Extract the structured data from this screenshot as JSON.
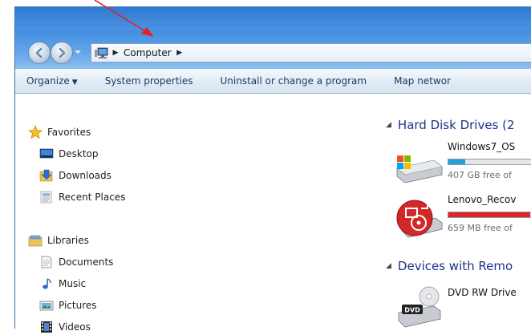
{
  "address_bar": {
    "breadcrumbs": [
      "Computer"
    ]
  },
  "toolbar": {
    "organize": "Organize",
    "system_properties": "System properties",
    "uninstall": "Uninstall or change a program",
    "map_network": "Map networ"
  },
  "nav_pane": {
    "favorites": {
      "label": "Favorites",
      "items": [
        "Desktop",
        "Downloads",
        "Recent Places"
      ]
    },
    "libraries": {
      "label": "Libraries",
      "items": [
        "Documents",
        "Music",
        "Pictures",
        "Videos"
      ]
    }
  },
  "content": {
    "hdd_group": {
      "title": "Hard Disk Drives (2",
      "drives": [
        {
          "name": "Windows7_OS",
          "free": "407 GB free of",
          "used_fraction": 0.2,
          "bar_color": "#26a0da"
        },
        {
          "name": "Lenovo_Recov",
          "free": "659 MB free of",
          "used_fraction": 0.97,
          "bar_color": "#da2626"
        }
      ]
    },
    "removable_group": {
      "title": "Devices with Remo",
      "devices": [
        {
          "name": "DVD RW Drive",
          "icon": "dvd-drive-icon",
          "badge": "DVD"
        }
      ]
    }
  },
  "colors": {
    "annotation_arrow": "#e8201e",
    "group_header": "#1e3287"
  }
}
